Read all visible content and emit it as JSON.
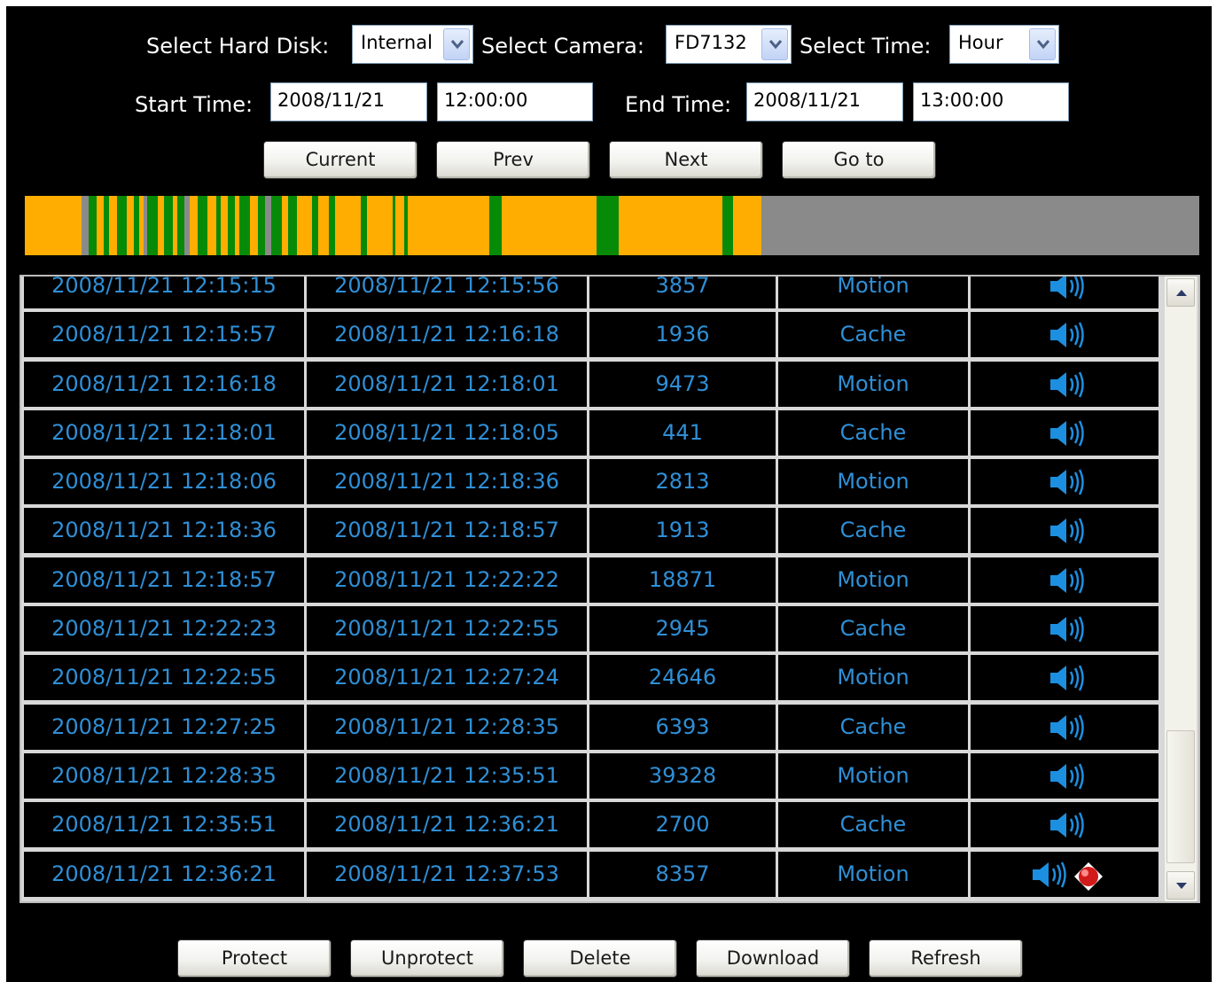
{
  "filters": {
    "hard_disk_label": "Select Hard Disk:",
    "hard_disk_value": "Internal",
    "camera_label": "Select Camera:",
    "camera_value": "FD7132",
    "time_label": "Select Time:",
    "time_value": "Hour",
    "start_label": "Start Time:",
    "start_date": "2008/11/21",
    "start_time": "12:00:00",
    "end_label": "End Time:",
    "end_date": "2008/11/21",
    "end_time": "13:00:00"
  },
  "nav_buttons": {
    "current": "Current",
    "prev": "Prev",
    "next": "Next",
    "goto": "Go to"
  },
  "timeline": {
    "description_colors": {
      "motion": "#ffad00",
      "cache": "#078a07",
      "no_data": "#8a8a8a"
    },
    "segments": [
      {
        "start": 0.0,
        "end": 2.2,
        "color": "#ffad00"
      },
      {
        "start": 2.2,
        "end": 3.4,
        "color": "#ffad00"
      },
      {
        "start": 3.4,
        "end": 3.8,
        "color": "#8a8a8a"
      },
      {
        "start": 3.8,
        "end": 4.3,
        "color": "#078a07"
      },
      {
        "start": 4.3,
        "end": 4.7,
        "color": "#ffad00"
      },
      {
        "start": 4.7,
        "end": 5.0,
        "color": "#078a07"
      },
      {
        "start": 5.0,
        "end": 5.5,
        "color": "#ffad00"
      },
      {
        "start": 5.5,
        "end": 6.1,
        "color": "#078a07"
      },
      {
        "start": 6.1,
        "end": 6.5,
        "color": "#ffad00"
      },
      {
        "start": 6.5,
        "end": 6.8,
        "color": "#078a07"
      },
      {
        "start": 6.8,
        "end": 7.1,
        "color": "#ffad00"
      },
      {
        "start": 7.1,
        "end": 7.3,
        "color": "#8a8a8a"
      },
      {
        "start": 7.3,
        "end": 7.9,
        "color": "#078a07"
      },
      {
        "start": 7.9,
        "end": 8.3,
        "color": "#ffad00"
      },
      {
        "start": 8.3,
        "end": 8.8,
        "color": "#078a07"
      },
      {
        "start": 8.8,
        "end": 9.1,
        "color": "#ffad00"
      },
      {
        "start": 9.1,
        "end": 9.5,
        "color": "#078a07"
      },
      {
        "start": 9.5,
        "end": 9.8,
        "color": "#8a8a8a"
      },
      {
        "start": 9.8,
        "end": 10.3,
        "color": "#ffad00"
      },
      {
        "start": 10.3,
        "end": 10.9,
        "color": "#078a07"
      },
      {
        "start": 10.9,
        "end": 11.4,
        "color": "#ffad00"
      },
      {
        "start": 11.4,
        "end": 11.7,
        "color": "#078a07"
      },
      {
        "start": 11.7,
        "end": 12.1,
        "color": "#ffad00"
      },
      {
        "start": 12.1,
        "end": 12.5,
        "color": "#078a07"
      },
      {
        "start": 12.5,
        "end": 12.8,
        "color": "#ffad00"
      },
      {
        "start": 12.8,
        "end": 13.4,
        "color": "#078a07"
      },
      {
        "start": 13.4,
        "end": 13.9,
        "color": "#ffad00"
      },
      {
        "start": 13.9,
        "end": 14.3,
        "color": "#078a07"
      },
      {
        "start": 14.3,
        "end": 14.7,
        "color": "#8a8a8a"
      },
      {
        "start": 14.7,
        "end": 15.3,
        "color": "#078a07"
      },
      {
        "start": 15.3,
        "end": 15.7,
        "color": "#ffad00"
      },
      {
        "start": 15.7,
        "end": 16.2,
        "color": "#078a07"
      },
      {
        "start": 16.2,
        "end": 17.1,
        "color": "#ffad00"
      },
      {
        "start": 17.1,
        "end": 17.5,
        "color": "#078a07"
      },
      {
        "start": 17.5,
        "end": 18.1,
        "color": "#ffad00"
      },
      {
        "start": 18.1,
        "end": 18.5,
        "color": "#078a07"
      },
      {
        "start": 18.5,
        "end": 20.0,
        "color": "#ffad00"
      },
      {
        "start": 20.0,
        "end": 20.4,
        "color": "#078a07"
      },
      {
        "start": 20.4,
        "end": 21.9,
        "color": "#ffad00"
      },
      {
        "start": 21.9,
        "end": 22.1,
        "color": "#078a07"
      },
      {
        "start": 22.1,
        "end": 22.6,
        "color": "#ffad00"
      },
      {
        "start": 22.6,
        "end": 22.8,
        "color": "#078a07"
      },
      {
        "start": 22.8,
        "end": 27.7,
        "color": "#ffad00"
      },
      {
        "start": 27.7,
        "end": 28.4,
        "color": "#078a07"
      },
      {
        "start": 28.4,
        "end": 34.1,
        "color": "#ffad00"
      },
      {
        "start": 34.1,
        "end": 35.4,
        "color": "#078a07"
      },
      {
        "start": 35.4,
        "end": 41.6,
        "color": "#ffad00"
      },
      {
        "start": 41.6,
        "end": 42.2,
        "color": "#078a07"
      },
      {
        "start": 42.2,
        "end": 43.9,
        "color": "#ffad00"
      }
    ],
    "total_minutes": 70
  },
  "records": [
    {
      "start": "2008/11/21 12:15:15",
      "end": "2008/11/21 12:15:56",
      "size": "3857",
      "type": "Motion",
      "protected": false
    },
    {
      "start": "2008/11/21 12:15:57",
      "end": "2008/11/21 12:16:18",
      "size": "1936",
      "type": "Cache",
      "protected": false
    },
    {
      "start": "2008/11/21 12:16:18",
      "end": "2008/11/21 12:18:01",
      "size": "9473",
      "type": "Motion",
      "protected": false
    },
    {
      "start": "2008/11/21 12:18:01",
      "end": "2008/11/21 12:18:05",
      "size": "441",
      "type": "Cache",
      "protected": false
    },
    {
      "start": "2008/11/21 12:18:06",
      "end": "2008/11/21 12:18:36",
      "size": "2813",
      "type": "Motion",
      "protected": false
    },
    {
      "start": "2008/11/21 12:18:36",
      "end": "2008/11/21 12:18:57",
      "size": "1913",
      "type": "Cache",
      "protected": false
    },
    {
      "start": "2008/11/21 12:18:57",
      "end": "2008/11/21 12:22:22",
      "size": "18871",
      "type": "Motion",
      "protected": false
    },
    {
      "start": "2008/11/21 12:22:23",
      "end": "2008/11/21 12:22:55",
      "size": "2945",
      "type": "Cache",
      "protected": false
    },
    {
      "start": "2008/11/21 12:22:55",
      "end": "2008/11/21 12:27:24",
      "size": "24646",
      "type": "Motion",
      "protected": false
    },
    {
      "start": "2008/11/21 12:27:25",
      "end": "2008/11/21 12:28:35",
      "size": "6393",
      "type": "Cache",
      "protected": false
    },
    {
      "start": "2008/11/21 12:28:35",
      "end": "2008/11/21 12:35:51",
      "size": "39328",
      "type": "Motion",
      "protected": false
    },
    {
      "start": "2008/11/21 12:35:51",
      "end": "2008/11/21 12:36:21",
      "size": "2700",
      "type": "Cache",
      "protected": false
    },
    {
      "start": "2008/11/21 12:36:21",
      "end": "2008/11/21 12:37:53",
      "size": "8357",
      "type": "Motion",
      "protected": true
    }
  ],
  "icons": {
    "audio": "speaker-icon",
    "protected": "record-marker-icon"
  },
  "colors": {
    "record_text": "#2f8fd6",
    "background": "#000000"
  },
  "action_buttons": {
    "protect": "Protect",
    "unprotect": "Unprotect",
    "delete": "Delete",
    "download": "Download",
    "refresh": "Refresh"
  }
}
